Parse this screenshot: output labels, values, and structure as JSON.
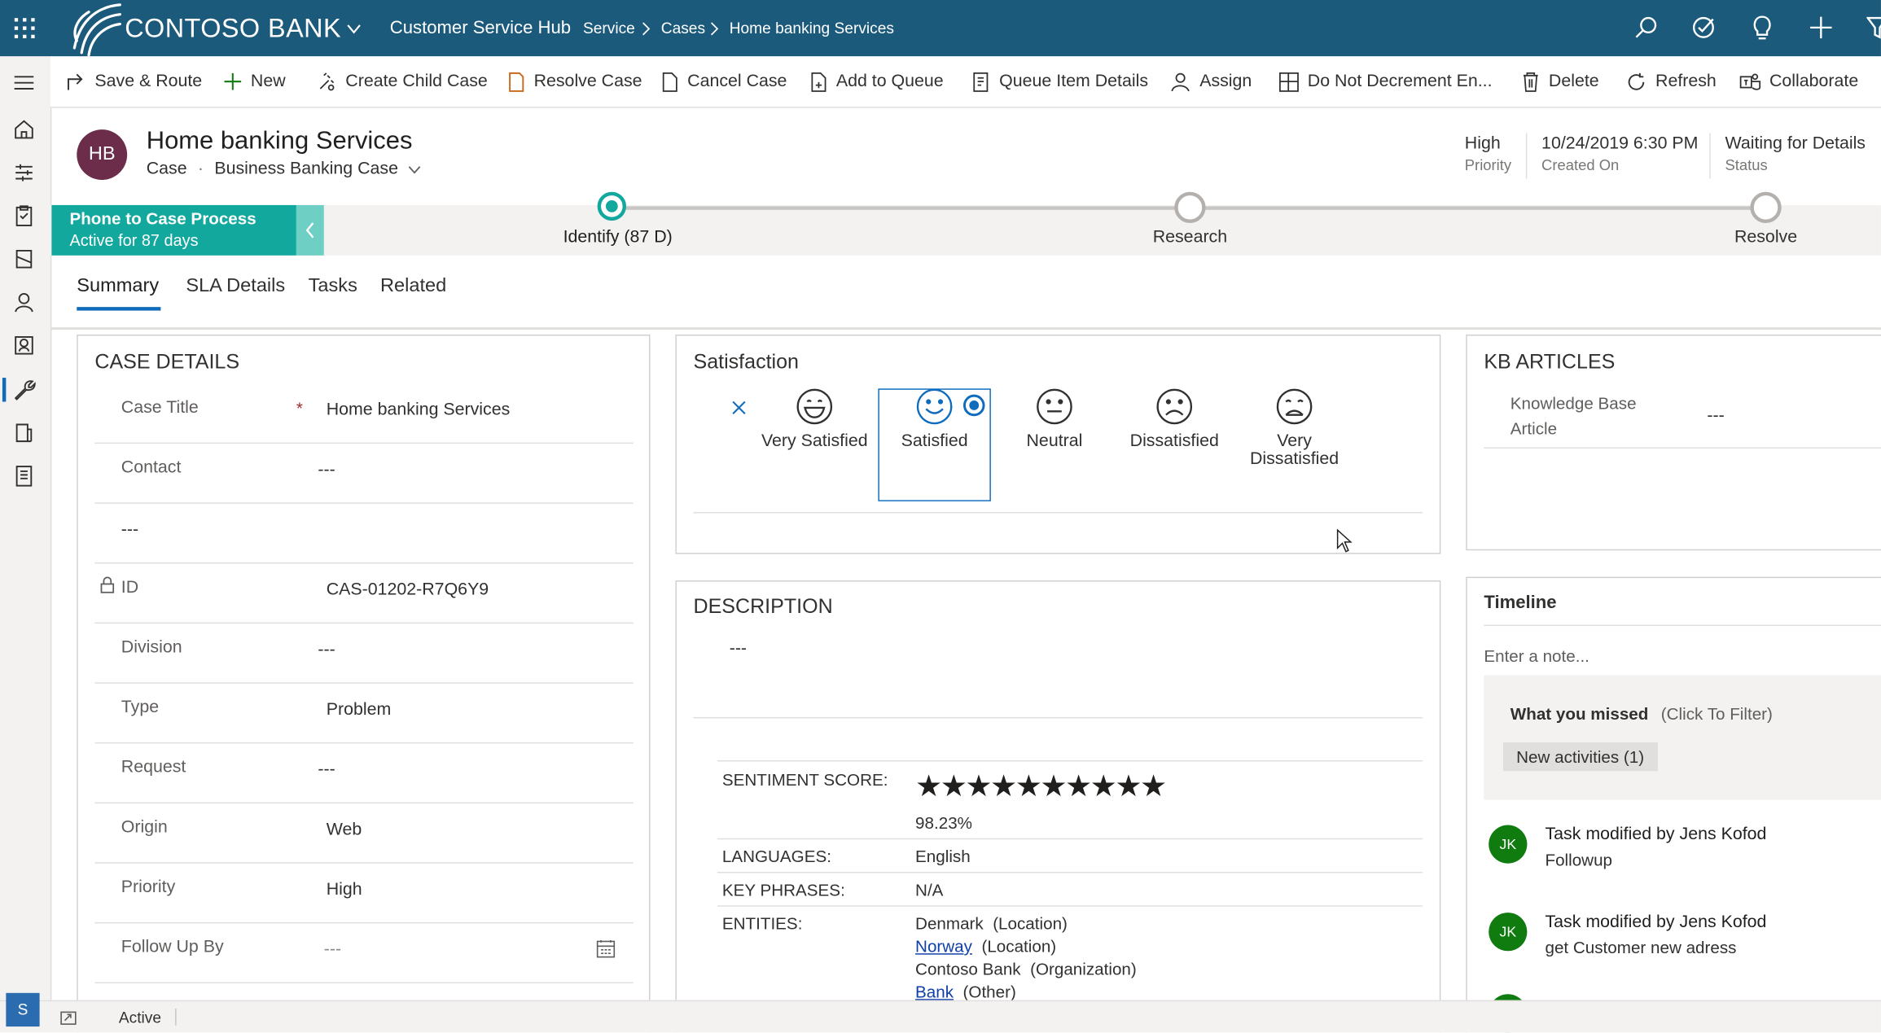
{
  "topbar": {
    "brand": "CONTOSO BANK",
    "app_name": "Customer Service Hub",
    "breadcrumb": [
      "Service",
      "Cases",
      "Home banking Services"
    ],
    "color": "#1c5a7c"
  },
  "commands": [
    "Save & Route",
    "New",
    "Create Child Case",
    "Resolve Case",
    "Cancel Case",
    "Add to Queue",
    "Queue Item Details",
    "Assign",
    "Do Not Decrement En...",
    "Delete",
    "Refresh",
    "Collaborate"
  ],
  "record": {
    "initials": "HB",
    "title": "Home banking Services",
    "entity": "Case",
    "form": "Business Banking Case",
    "avatar_color": "#6b2d4a",
    "header_fields": [
      {
        "value": "High",
        "label": "Priority"
      },
      {
        "value": "10/24/2019 6:30 PM",
        "label": "Created On"
      },
      {
        "value": "Waiting for Details",
        "label": "Status"
      }
    ]
  },
  "process": {
    "name": "Phone to Case Process",
    "active_for": "Active for 87 days",
    "color": "#13a89e",
    "stages": [
      {
        "label": "Identify",
        "duration": "(87 D)"
      },
      {
        "label": "Research"
      },
      {
        "label": "Resolve"
      }
    ]
  },
  "tabs": [
    "Summary",
    "SLA Details",
    "Tasks",
    "Related"
  ],
  "case_details": {
    "heading": "CASE DETAILS",
    "fields": [
      {
        "label": "Case Title",
        "value": "Home banking Services",
        "required": "*"
      },
      {
        "label": "Contact",
        "value": "---"
      },
      {
        "label": "",
        "value": "---"
      },
      {
        "label": "ID",
        "value": "CAS-01202-R7Q6Y9"
      },
      {
        "label": "Division",
        "value": "---"
      },
      {
        "label": "Type",
        "value": "Problem"
      },
      {
        "label": "Request",
        "value": "---"
      },
      {
        "label": "Origin",
        "value": "Web"
      },
      {
        "label": "Priority",
        "value": "High"
      },
      {
        "label": "Follow Up By",
        "value": "---"
      }
    ]
  },
  "satisfaction": {
    "heading": "Satisfaction",
    "options": [
      "Very Satisfied",
      "Satisfied",
      "Neutral",
      "Dissatisfied",
      "Very Dissatisfied"
    ],
    "selected": "Satisfied"
  },
  "description": {
    "heading": "DESCRIPTION",
    "value": "---",
    "sentiment_label": "SENTIMENT SCORE:",
    "stars": "★★★★★★★★★★",
    "sentiment_value": "98.23%",
    "languages_label": "LANGUAGES:",
    "languages_value": "English",
    "key_phrases_label": "KEY PHRASES:",
    "key_phrases_value": "N/A",
    "entities_label": "ENTITIES:",
    "entities": [
      {
        "name": "Denmark",
        "type": "(Location)"
      },
      {
        "name": "Norway",
        "type": "(Location)"
      },
      {
        "name": "Contoso Bank",
        "type": "(Organization)"
      },
      {
        "name": "Bank",
        "type": "(Other)"
      }
    ]
  },
  "kb": {
    "heading": "KB ARTICLES",
    "label": "Knowledge Base Article",
    "value": "---"
  },
  "timeline": {
    "heading": "Timeline",
    "note_placeholder": "Enter a note...",
    "missed_title": "What you missed",
    "missed_filter": "(Click To Filter)",
    "new_activities": "New activities (1)",
    "items": [
      {
        "initials": "JK",
        "title": "Task modified by Jens Kofod",
        "subtitle": "Followup"
      },
      {
        "initials": "JK",
        "title": "Task modified by Jens Kofod",
        "subtitle": "get Customer new adress"
      }
    ]
  },
  "statusbar": {
    "user_initial": "S",
    "status": "Active"
  }
}
